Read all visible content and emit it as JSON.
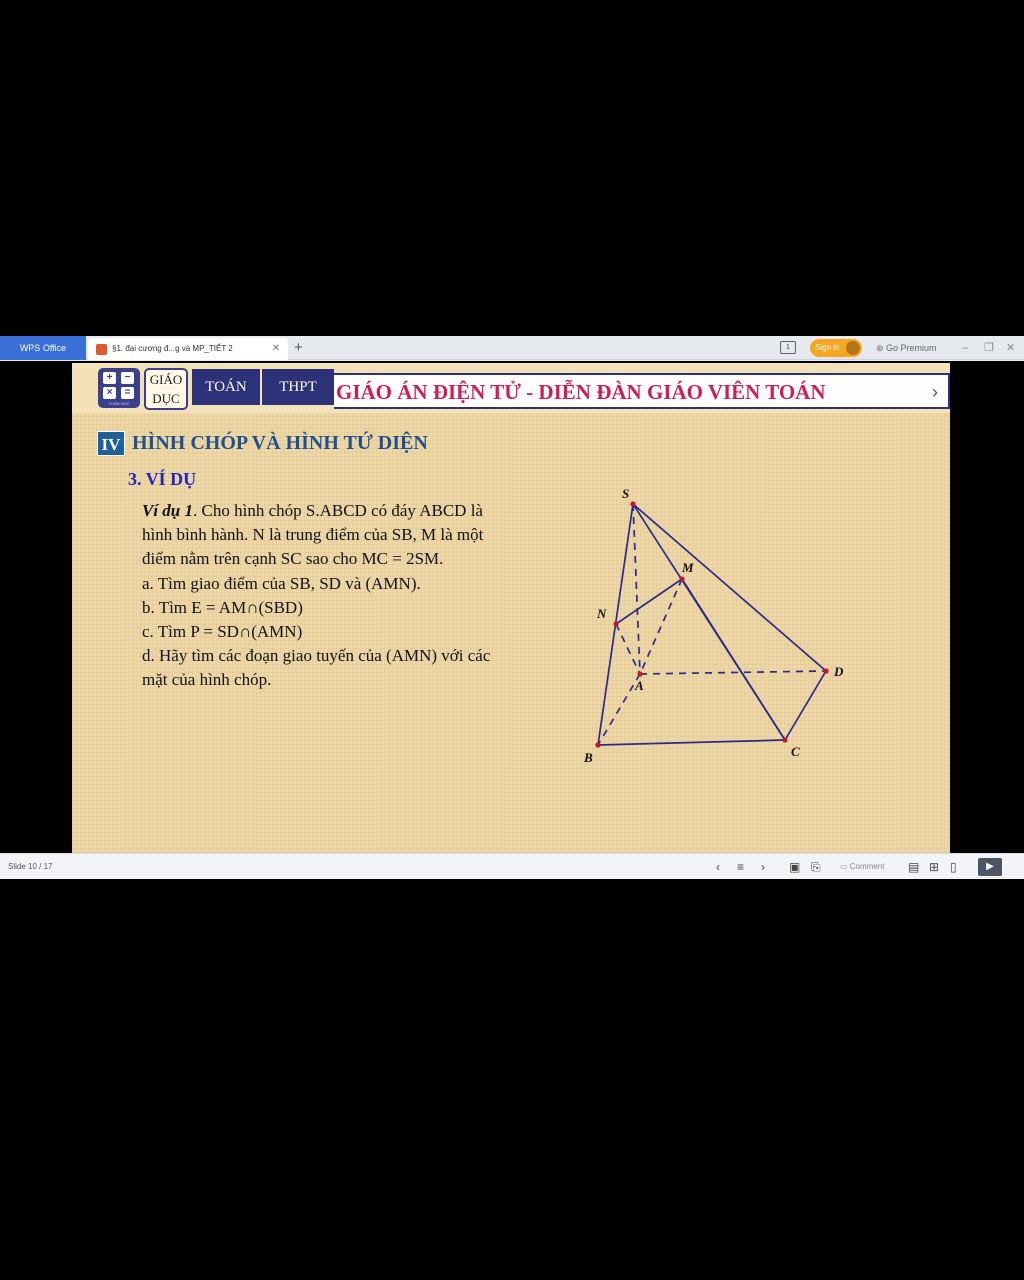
{
  "app": {
    "brand": "WPS Office",
    "doc_tab": "§1. đại cương đ...g và MP_TIẾT 2",
    "new_tab": "+",
    "tab_count": "1",
    "signin": "Sign in",
    "premium": "Go Premium"
  },
  "slide": {
    "header": {
      "logo_sub": "TOÁN HỌC",
      "giao": "GIÁO",
      "duc": "DỤC",
      "toan": "TOÁN",
      "thpt": "THPT",
      "banner": "GIÁO ÁN ĐIỆN TỬ - DIỄN ĐÀN GIÁO VIÊN TOÁN"
    },
    "section_number": "IV",
    "section_title": "HÌNH CHÓP VÀ HÌNH TỨ DIỆN",
    "subsection": "3. VÍ DỤ",
    "problem": {
      "label": "Ví dụ 1",
      "lines": [
        ". Cho hình chóp S.ABCD có đáy ABCD là",
        "hình bình hành. N là trung điểm của SB, M là một",
        "điểm nằm trên cạnh SC sao cho MC = 2SM.",
        "a. Tìm giao điểm của SB, SD và (AMN).",
        "b. Tìm E = AM∩(SBD)",
        "c. Tìm P = SD∩(AMN)",
        "d. Hãy tìm các đoạn giao tuyến của (AMN) với các",
        "mặt của hình chóp."
      ]
    },
    "figure": {
      "points": {
        "S": "S",
        "M": "M",
        "N": "N",
        "A": "A",
        "B": "B",
        "C": "C",
        "D": "D"
      },
      "line_color": "#2a2a8a",
      "point_color": "#c0182a"
    }
  },
  "status": {
    "slide_number": "Slide 10 / 17",
    "comment": "Comment"
  }
}
